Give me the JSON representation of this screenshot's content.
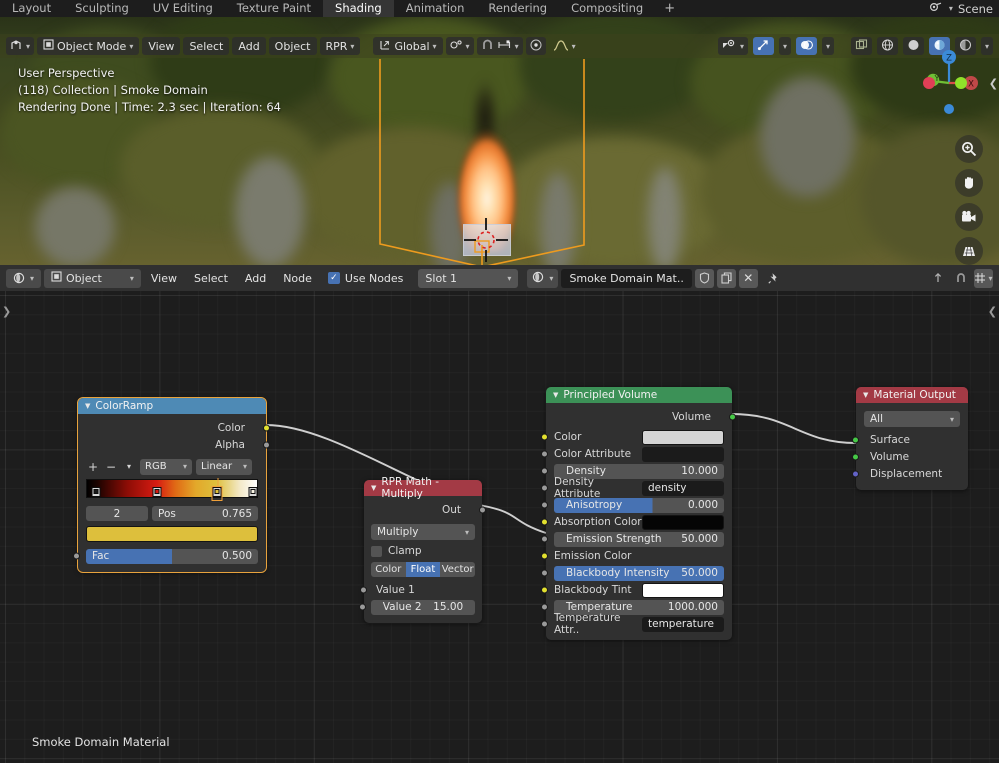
{
  "topbar": {
    "workspaces": [
      {
        "label": "Layout",
        "active": false
      },
      {
        "label": "Sculpting",
        "active": false
      },
      {
        "label": "UV Editing",
        "active": false
      },
      {
        "label": "Texture Paint",
        "active": false
      },
      {
        "label": "Shading",
        "active": true
      },
      {
        "label": "Animation",
        "active": false
      },
      {
        "label": "Rendering",
        "active": false
      },
      {
        "label": "Compositing",
        "active": false
      }
    ],
    "add_workspace": "+",
    "scene_name": "Scene",
    "scene_icon": "scene-icon"
  },
  "viewport": {
    "header": {
      "editor_type_icon": "editor-type-3dview-icon",
      "mode": "Object Mode",
      "mode_icon": "object-mode-icon",
      "menus": [
        "View",
        "Select",
        "Add",
        "Object",
        "RPR"
      ],
      "transform_orientation": "Global",
      "transform_orientation_icon": "orientation-icon",
      "snap_icon": "snap-magnet-icon",
      "pivot_icon": "pivot-point-icon",
      "proportional_icon": "proportional-editing-icon",
      "proportional_falloff_icon": "falloff-smooth-icon",
      "visibility_icon": "show-hide-icon",
      "gizmo_icon": "gizmo-icon",
      "overlays_icon": "overlays-icon",
      "xray_icon": "xray-toggle-icon",
      "shading_modes": [
        "wireframe-icon",
        "solid-icon",
        "material-preview-icon",
        "rendered-icon"
      ],
      "shading_active_index": 2
    },
    "overlay_lines": [
      "User Perspective",
      "(118) Collection | Smoke Domain",
      "Rendering Done | Time: 2.3 sec | Iteration: 64"
    ],
    "gizmo_axes": [
      "X",
      "Y",
      "Z"
    ],
    "nav_tools": [
      "zoom-icon",
      "pan-hand-icon",
      "camera-view-icon",
      "toggle-perspective-icon"
    ],
    "edge_arrow_icon": "collapse-sidebar-icon"
  },
  "shader_header": {
    "editor_type_icon": "editor-type-shader-icon",
    "shader_type": "Object",
    "shader_type_icon": "object-data-icon",
    "menus": [
      "View",
      "Select",
      "Add",
      "Node"
    ],
    "use_nodes_label": "Use Nodes",
    "use_nodes_checked": true,
    "slot": "Slot 1",
    "browse_material_icon": "browse-material-icon",
    "material_name": "Smoke Domain Mat..",
    "fake_user_icon": "shield-fake-user-icon",
    "new_material_icon": "duplicate-material-icon",
    "unlink_icon": "unlink-x-icon",
    "pin_icon": "pin-icon",
    "snap_node_icon": "node-snap-icon",
    "proportional_node_icon": "proportional-node-icon",
    "overlay_node_icon": "node-overlay-icon"
  },
  "node_editor": {
    "bottom_label": "Smoke Domain Material",
    "left_arrow_icon": "open-toolbar-icon",
    "right_arrow_icon": "open-sidebar-icon",
    "nodes": {
      "colorramp": {
        "title": "ColorRamp",
        "header_color": "#4e8ab5",
        "outputs": [
          "Color",
          "Alpha"
        ],
        "add_label": "+",
        "remove_label": "−",
        "menu_label": "∨",
        "interpolation_mode": "RGB",
        "interpolation": "Linear",
        "index": "2",
        "pos_label": "Pos",
        "pos_value": "0.765",
        "selected_color": "#ddbf3c",
        "input_label": "Fac",
        "input_value": "0.500",
        "stops": [
          {
            "pos": 0.055,
            "color": "#1a1a1a"
          },
          {
            "pos": 0.41,
            "color": "#d61b12"
          },
          {
            "pos": 0.765,
            "color": "#ddbf3c"
          },
          {
            "pos": 0.975,
            "color": "#f9f5e6"
          }
        ]
      },
      "rpr_math": {
        "title": "RPR Math - Multiply",
        "header_color": "#a33a45",
        "output_label": "Out",
        "operation": "Multiply",
        "clamp_label": "Clamp",
        "clamp_checked": false,
        "data_types": [
          "Color",
          "Float",
          "Vector"
        ],
        "data_type_active": "Float",
        "value1_label": "Value 1",
        "value2_label": "Value 2",
        "value2_value": "15.00"
      },
      "principled_volume": {
        "title": "Principled Volume",
        "header_color": "#3c9157",
        "output_label": "Volume",
        "rows": [
          {
            "label": "Color",
            "kind": "swatch",
            "value": "#d4d4d4",
            "socket": "yellow",
            "highlight": false
          },
          {
            "label": "Color Attribute",
            "kind": "text",
            "value": "",
            "socket": "gray",
            "highlight": false
          },
          {
            "label": "Density",
            "kind": "slider",
            "value": "10.000",
            "socket": "gray",
            "highlight": false
          },
          {
            "label": "Density Attribute",
            "kind": "text",
            "value": "density",
            "socket": "gray",
            "highlight": false
          },
          {
            "label": "Anisotropy",
            "kind": "slider",
            "value": "0.000",
            "socket": "gray",
            "highlight": true
          },
          {
            "label": "Absorption Color",
            "kind": "swatch",
            "value": "#050505",
            "socket": "yellow",
            "highlight": false
          },
          {
            "label": "Emission Strength",
            "kind": "slider",
            "value": "50.000",
            "socket": "gray",
            "highlight": false
          },
          {
            "label": "Emission Color",
            "kind": "none",
            "value": "",
            "socket": "yellow",
            "highlight": false
          },
          {
            "label": "Blackbody Intensity",
            "kind": "slider",
            "value": "50.000",
            "socket": "gray",
            "highlight": true
          },
          {
            "label": "Blackbody Tint",
            "kind": "swatch",
            "value": "#ffffff",
            "socket": "yellow",
            "highlight": false
          },
          {
            "label": "Temperature",
            "kind": "slider",
            "value": "1000.000",
            "socket": "gray",
            "highlight": false
          },
          {
            "label": "Temperature Attr..",
            "kind": "text",
            "value": "temperature",
            "socket": "gray",
            "highlight": false
          }
        ]
      },
      "material_output": {
        "title": "Material Output",
        "header_color": "#a33a45",
        "target": "All",
        "inputs": [
          {
            "label": "Surface",
            "socket": "green"
          },
          {
            "label": "Volume",
            "socket": "green"
          },
          {
            "label": "Displacement",
            "socket": "violet"
          }
        ]
      }
    }
  }
}
